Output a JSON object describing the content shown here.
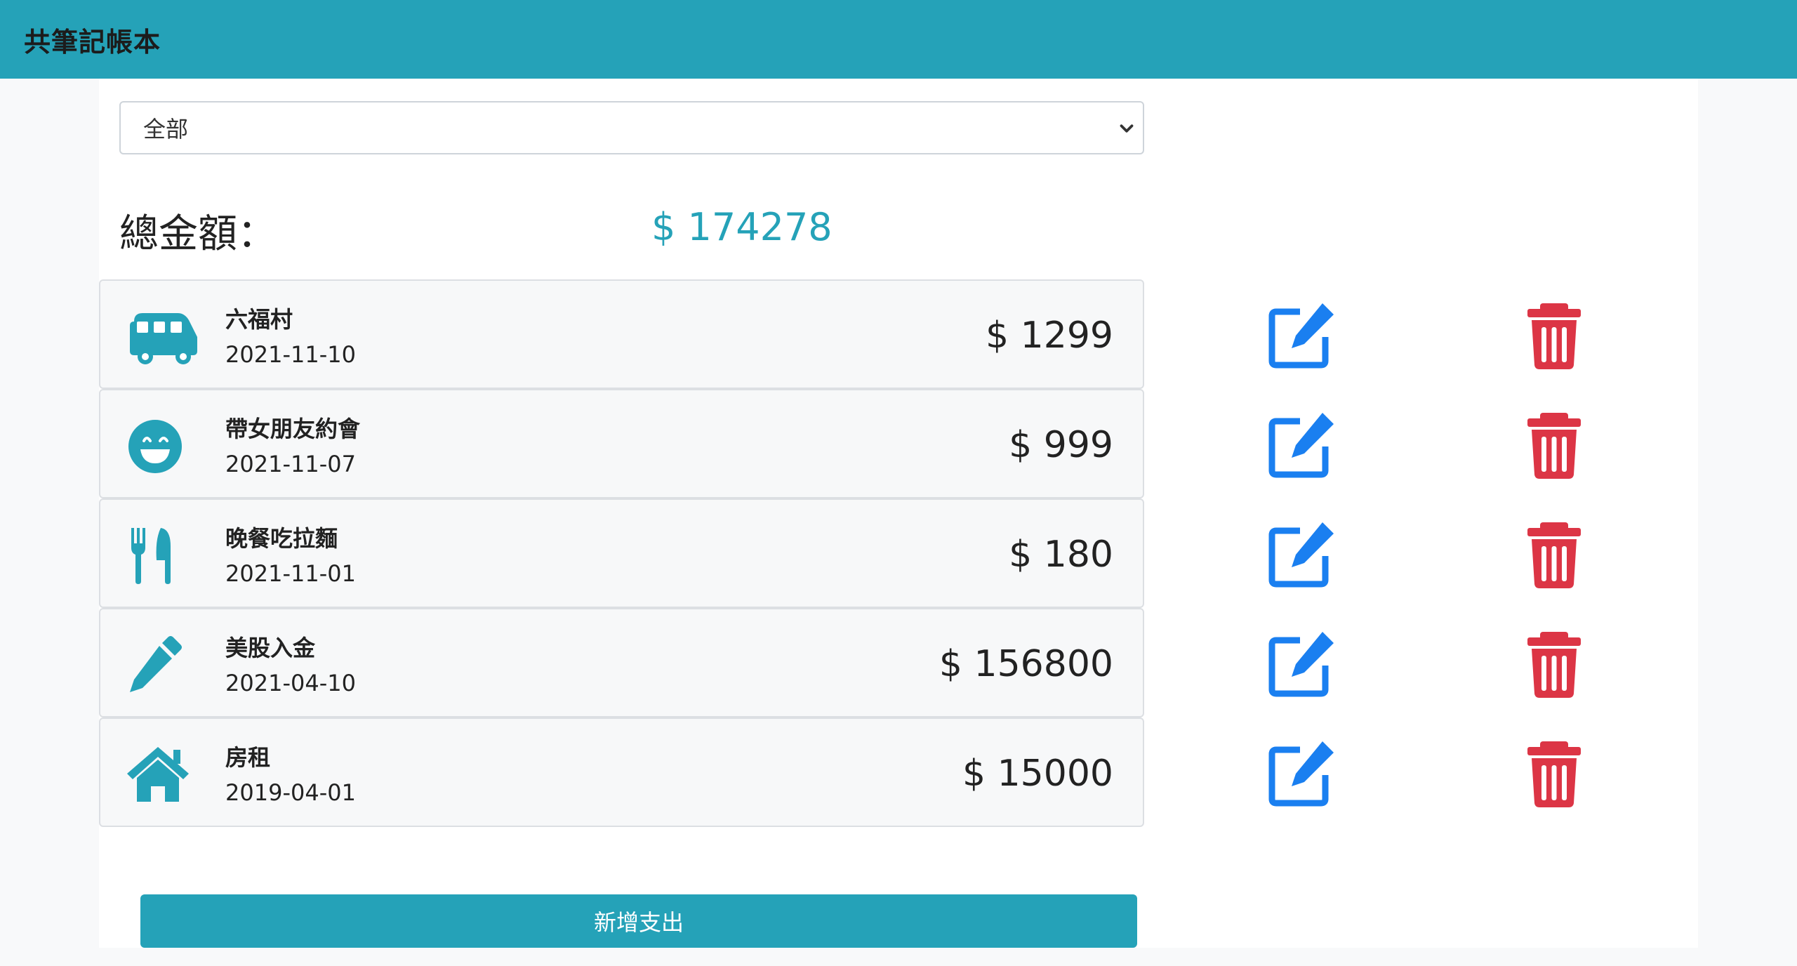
{
  "app": {
    "title": "共筆記帳本"
  },
  "filter": {
    "selected": "全部"
  },
  "summary": {
    "label": "總金額：",
    "value": "$ 174278"
  },
  "records": [
    {
      "icon": "bus-icon",
      "name": "六福村",
      "date": "2021-11-10",
      "amount": "$ 1299"
    },
    {
      "icon": "smile-icon",
      "name": "帶女朋友約會",
      "date": "2021-11-07",
      "amount": "$ 999"
    },
    {
      "icon": "utensils-icon",
      "name": "晚餐吃拉麵",
      "date": "2021-11-01",
      "amount": "$ 180"
    },
    {
      "icon": "pen-icon",
      "name": "美股入金",
      "date": "2021-04-10",
      "amount": "$ 156800"
    },
    {
      "icon": "home-icon",
      "name": "房租",
      "date": "2019-04-01",
      "amount": "$ 15000"
    }
  ],
  "actions": {
    "add_label": "新增支出"
  },
  "colors": {
    "primary": "#25a2b8",
    "edit": "#1a7ff0",
    "delete": "#dc3545"
  }
}
